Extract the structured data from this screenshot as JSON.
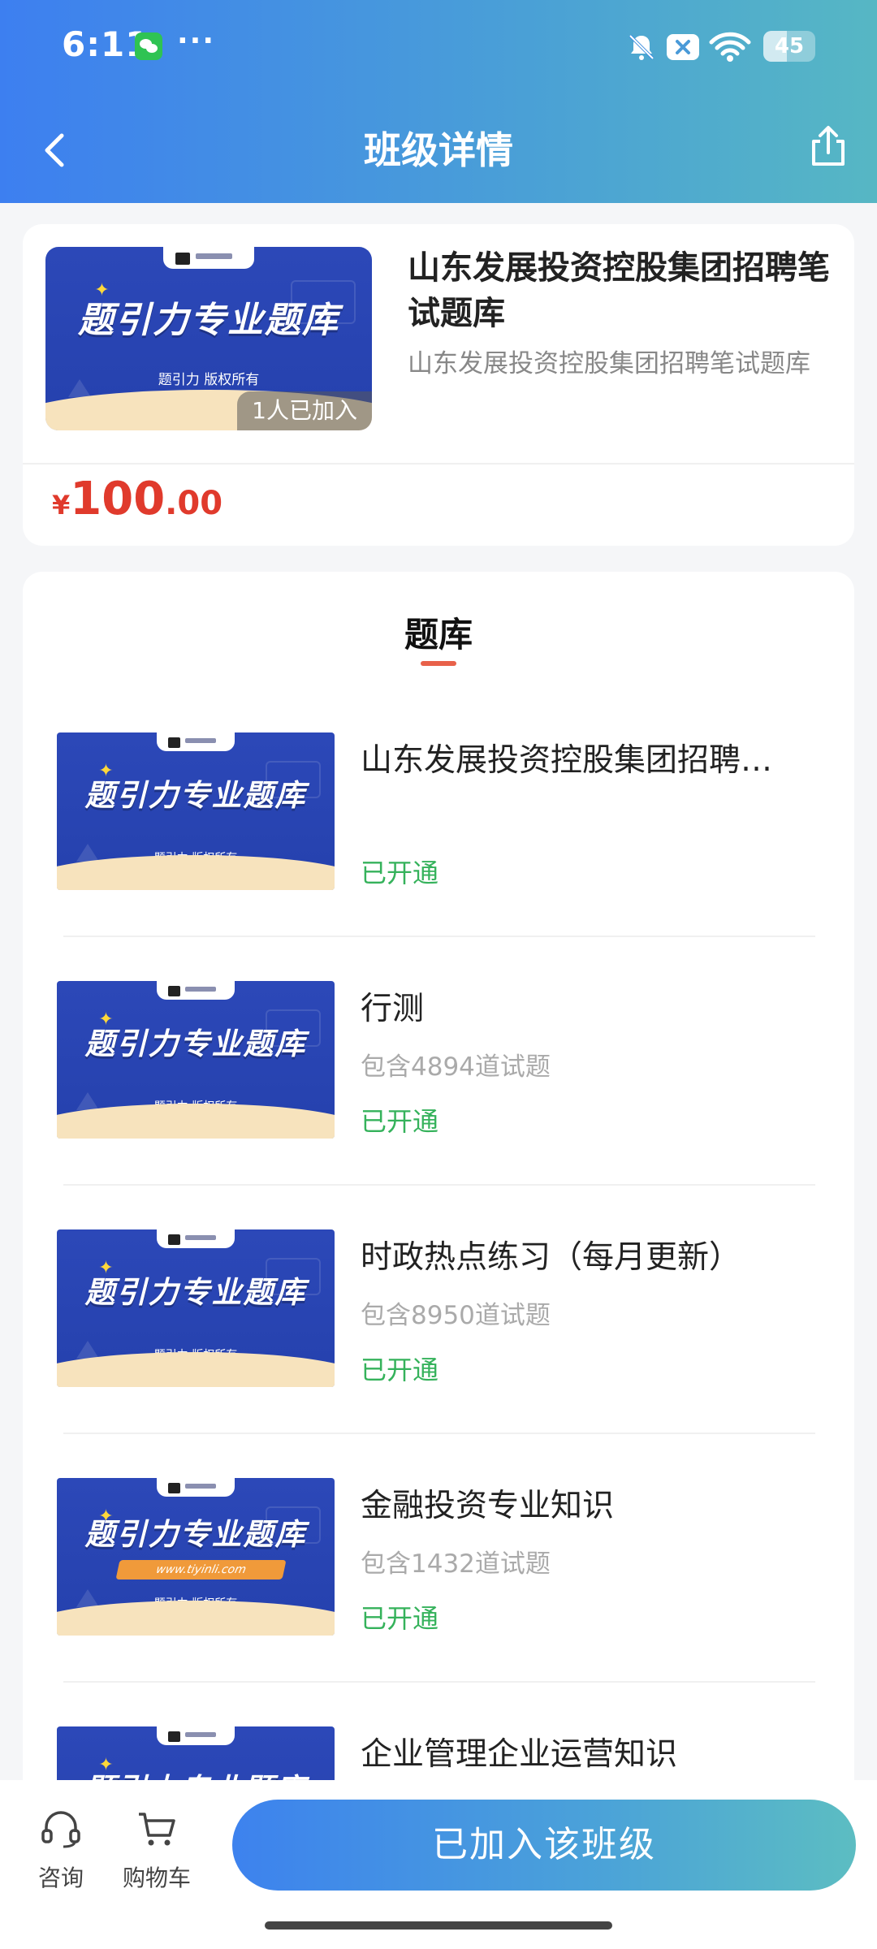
{
  "status_bar": {
    "time": "6:11",
    "more": "···",
    "battery": "45",
    "icons": [
      "wechat-icon",
      "mute-bell-icon",
      "close-badge-icon",
      "wifi-icon",
      "battery-icon"
    ]
  },
  "nav": {
    "title": "班级详情",
    "icons": [
      "back-arrow-icon",
      "share-icon"
    ]
  },
  "class_card": {
    "banner": {
      "title": "题引力专业题库",
      "copyright": "题引力 版权所有"
    },
    "joined": "1人已加入",
    "title": "山东发展投资控股集团招聘笔试题库",
    "subtitle": "山东发展投资控股集团招聘笔试题库",
    "price": {
      "symbol": "¥",
      "integer": "100",
      "decimal": ".00"
    }
  },
  "section": {
    "title": "题库"
  },
  "banks": [
    {
      "name": "山东发展投资控股集团招聘…",
      "count": "",
      "status": "已开通",
      "banner_title": "题引力专业题库",
      "banner_copy": "题引力 版权所有"
    },
    {
      "name": "行测",
      "count": "包含4894道试题",
      "status": "已开通",
      "banner_title": "题引力专业题库",
      "banner_copy": "题引力 版权所有"
    },
    {
      "name": "时政热点练习（每月更新）",
      "count": "包含8950道试题",
      "status": "已开通",
      "banner_title": "题引力专业题库",
      "banner_copy": "题引力 版权所有"
    },
    {
      "name": "金融投资专业知识",
      "count": "包含1432道试题",
      "status": "已开通",
      "banner_title": "题引力专业题库",
      "banner_copy": "题引力 版权所有",
      "banner_url": "www.tiyinli.com"
    },
    {
      "name": "企业管理企业运营知识",
      "count": "",
      "status": "",
      "banner_title": "题引力专业题库",
      "banner_copy": ""
    }
  ],
  "bottom_bar": {
    "consult_label": "咨询",
    "cart_label": "购物车",
    "join_button": "已加入该班级",
    "icons": [
      "headset-icon",
      "cart-icon"
    ]
  },
  "colors": {
    "header_start": "#3d7ff0",
    "header_end": "#56b7c4",
    "price": "#e03a2c",
    "status_open": "#35b25b",
    "underline": "#e8614a"
  }
}
